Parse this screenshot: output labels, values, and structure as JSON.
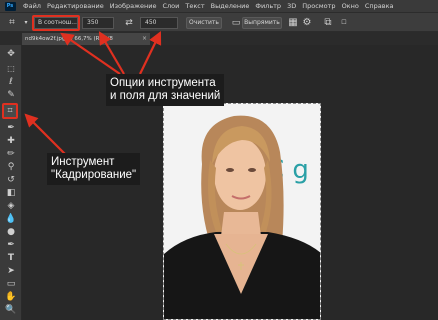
{
  "menubar": {
    "logo": "Ps",
    "items": [
      "Файл",
      "Редактирование",
      "Изображение",
      "Слои",
      "Текст",
      "Выделение",
      "Фильтр",
      "3D",
      "Просмотр",
      "Окно",
      "Справка"
    ]
  },
  "options": {
    "aspect_select": "В соотнош...",
    "width_value": "350",
    "height_value": "450",
    "clear_label": "Очистить",
    "straighten_label": "Выпрямить"
  },
  "document": {
    "tab_label": "nd9k4ow2f.jpg @ 66,7% (RGB/8",
    "tab_close": "×"
  },
  "annotations": {
    "options_line1": "Опции инструмента",
    "options_line2": "и поля для значений",
    "crop_line1": "Инструмент",
    "crop_line2": "\"Кадрирование\""
  },
  "colors": {
    "highlight": "#e03020",
    "photo_background": "#f4f4f4",
    "brand_logo": "#31a8ff"
  },
  "photo": {
    "logo_text": "C g"
  }
}
